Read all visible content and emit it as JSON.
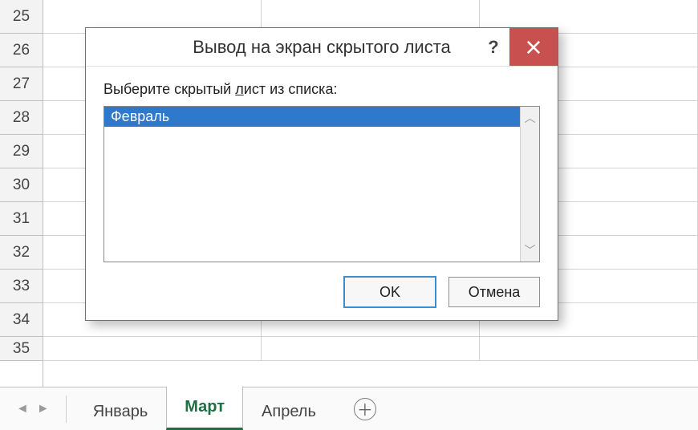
{
  "rows": [
    "25",
    "26",
    "27",
    "28",
    "29",
    "30",
    "31",
    "32",
    "33",
    "34",
    "35"
  ],
  "sheet_tabs": {
    "items": [
      "Январь",
      "Март",
      "Апрель"
    ],
    "active_index": 1
  },
  "dialog": {
    "title": "Вывод на экран скрытого листа",
    "label_pre": "Выберите скрытый ",
    "label_mnemonic": "л",
    "label_post": "ист из списка:",
    "items": [
      "Февраль"
    ],
    "ok_label": "OK",
    "cancel_label": "Отмена",
    "help_label": "?",
    "close_label": "✕"
  }
}
